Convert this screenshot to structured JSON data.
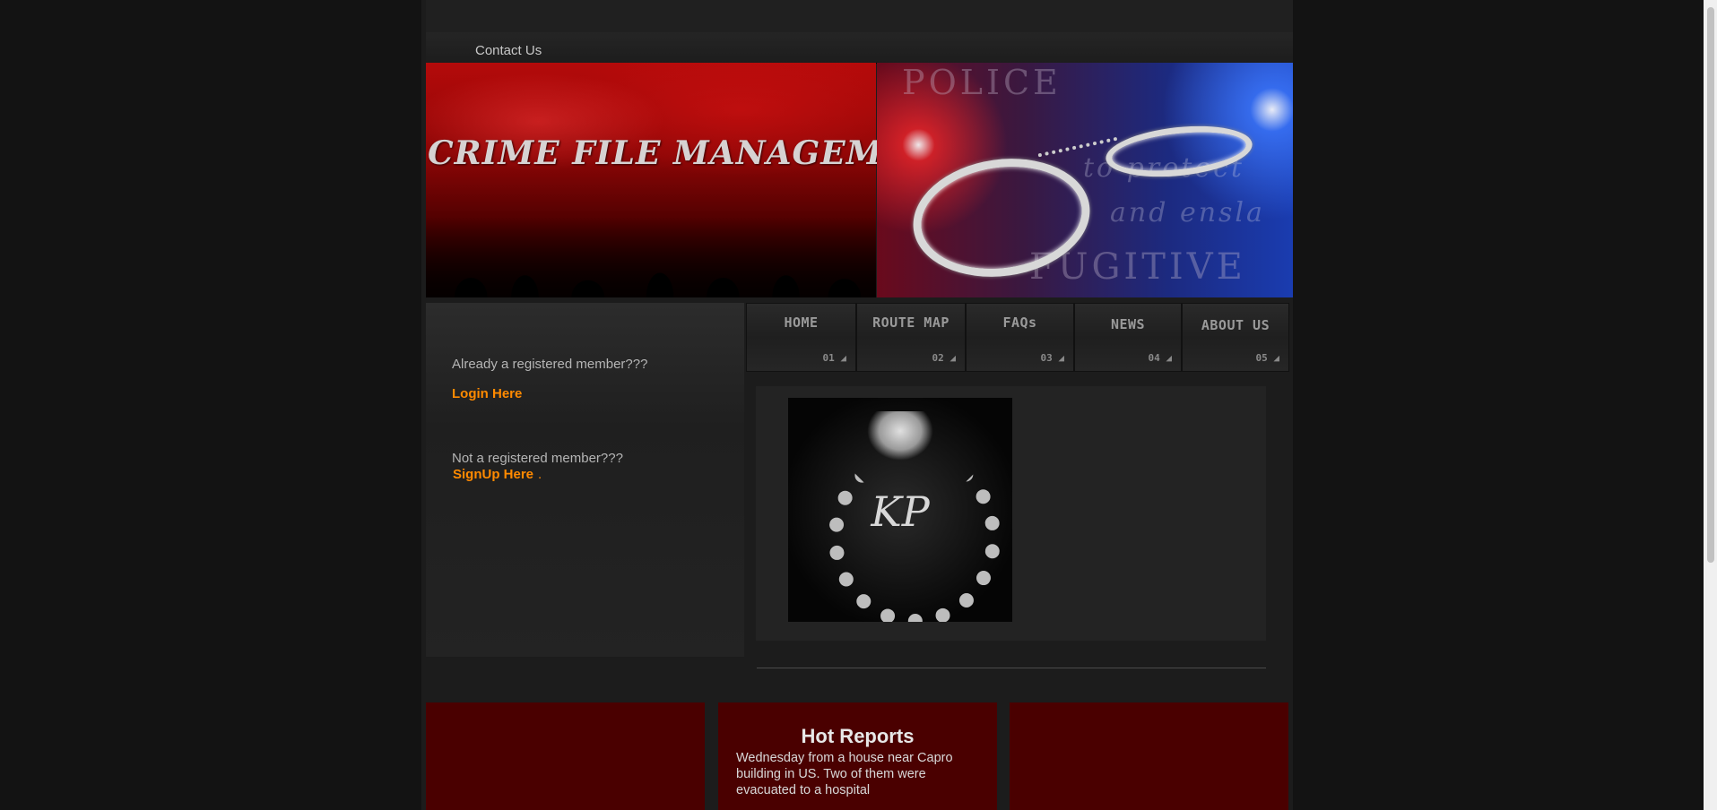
{
  "header": {
    "contact_label": "Contact Us"
  },
  "banner": {
    "title": "CRIME FILE MANAGEMENT",
    "right_top_word": "POLICE",
    "right_bottom_word": "FUGITIVE",
    "motto_line1": "to protect",
    "motto_line2": "and ensla"
  },
  "login_panel": {
    "already_text": "Already a registered member???",
    "login_link": "Login Here",
    "not_registered_text": "Not a registered member???",
    "signup_link": "SignUp Here",
    "signup_suffix": "."
  },
  "nav": {
    "items": [
      {
        "label": "HOME",
        "num": "01 ◢"
      },
      {
        "label": "ROUTE MAP",
        "num": "02 ◢"
      },
      {
        "label": "FAQs",
        "num": "03 ◢"
      },
      {
        "label": "NEWS",
        "num": "04 ◢"
      },
      {
        "label": "ABOUT US",
        "num": "05 ◢"
      }
    ]
  },
  "content": {
    "emblem_text": "KP"
  },
  "hot_reports": {
    "title": "Hot Reports",
    "text": "Wednesday from a house near Capro building in US. Two of them were evacuated to a hospital"
  },
  "colors": {
    "accent": "#ff8a00",
    "panel_red": "#4a0000",
    "background": "#131313"
  }
}
